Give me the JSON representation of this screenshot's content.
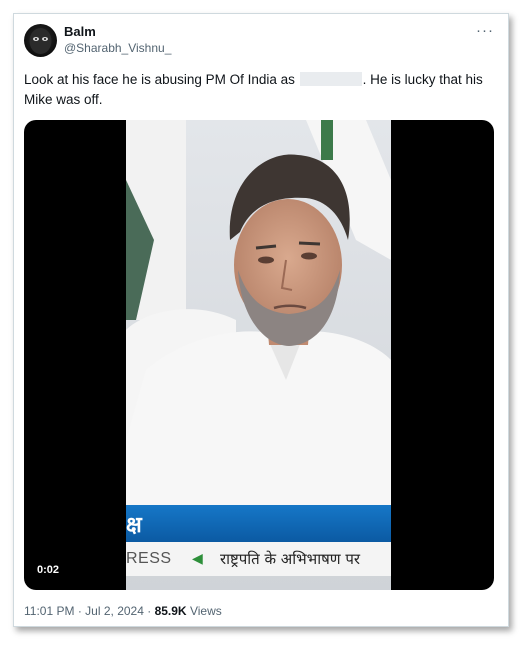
{
  "tweet": {
    "author": {
      "display_name": "Balm",
      "handle": "@Sharabh_Vishnu_",
      "avatar_icon": "dark-face-avatar"
    },
    "more_icon": "···",
    "text_before_redaction": "Look at his face he is abusing PM Of India as",
    "text_after_redaction": ". He is lucky that his Mike was off."
  },
  "media": {
    "type": "video",
    "duration": "0:02",
    "ticker_top_text": "क्ष",
    "ticker_left_text": "RESS",
    "ticker_arrow": "◀",
    "ticker_right_text": "राष्ट्रपति के अभिभाषण पर"
  },
  "meta": {
    "time": "11:01 PM",
    "separator": "·",
    "date": "Jul 2, 2024",
    "views_count": "85.9K",
    "views_label": "Views"
  },
  "colors": {
    "border": "#cfd9de",
    "text_primary": "#0f1419",
    "text_secondary": "#536471",
    "ticker_blue": "#0b5aa3",
    "ticker_arrow_green": "#2d8f3a"
  }
}
